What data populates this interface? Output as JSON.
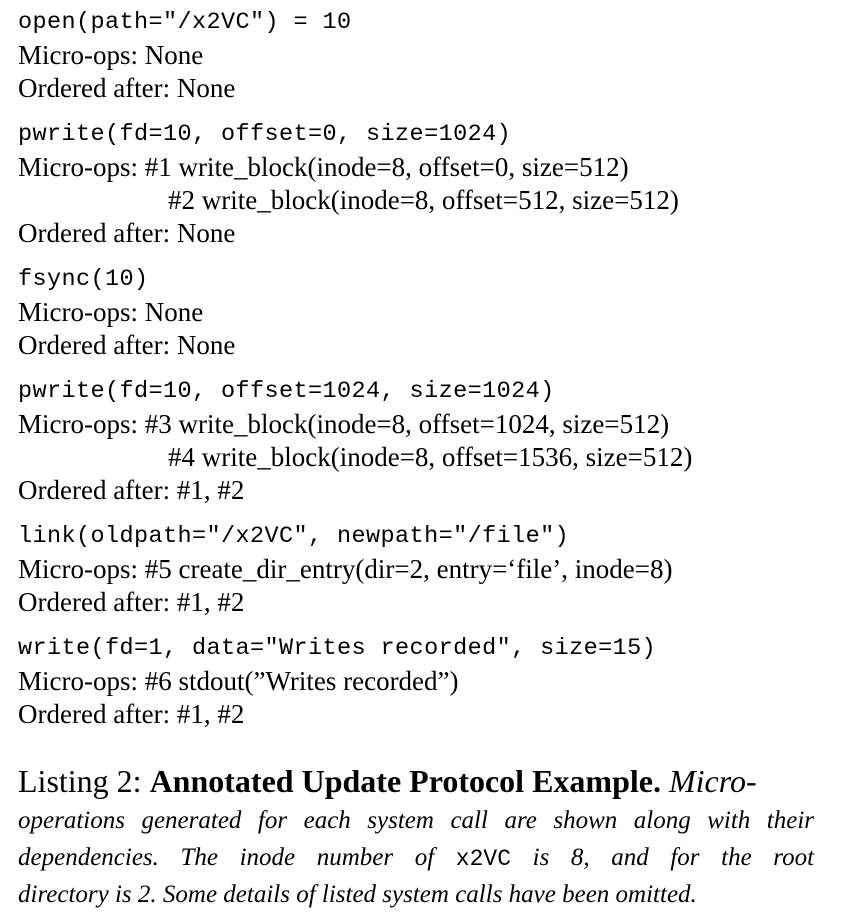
{
  "listing": {
    "blocks": [
      {
        "syscall": "open(path=\"/x2VC\") = 10",
        "microops_label": "Micro-ops:",
        "microops": [
          "None"
        ],
        "ordered_label": "Ordered after:",
        "ordered": "None"
      },
      {
        "syscall": "pwrite(fd=10, offset=0, size=1024)",
        "microops_label": "Micro-ops:",
        "microops": [
          "#1 write_block(inode=8, offset=0, size=512)",
          "#2 write_block(inode=8, offset=512, size=512)"
        ],
        "ordered_label": "Ordered after:",
        "ordered": "None"
      },
      {
        "syscall": "fsync(10)",
        "microops_label": "Micro-ops:",
        "microops": [
          "None"
        ],
        "ordered_label": "Ordered after:",
        "ordered": "None"
      },
      {
        "syscall": "pwrite(fd=10, offset=1024, size=1024)",
        "microops_label": "Micro-ops:",
        "microops": [
          "#3 write_block(inode=8, offset=1024, size=512)",
          "#4 write_block(inode=8, offset=1536, size=512)"
        ],
        "ordered_label": "Ordered after:",
        "ordered": "#1, #2"
      },
      {
        "syscall": "link(oldpath=\"/x2VC\", newpath=\"/file\")",
        "microops_label": "Micro-ops:",
        "microops": [
          "#5 create_dir_entry(dir=2, entry=‘file’, inode=8)"
        ],
        "ordered_label": "Ordered after:",
        "ordered": "#1, #2"
      },
      {
        "syscall": "write(fd=1, data=\"Writes recorded\", size=15)",
        "microops_label": "Micro-ops:",
        "microops": [
          "#6 stdout(”Writes recorded”)"
        ],
        "ordered_label": "Ordered after:",
        "ordered": "#1, #2"
      }
    ]
  },
  "caption": {
    "label": "Listing 2:",
    "title": "Annotated Update Protocol Example.",
    "line1_start": "Micro-",
    "line2": "operations generated for each system call are shown along with their",
    "line3_pre": "dependencies.  The inode number of",
    "line3_code": "x2VC",
    "line3_post": "is 8, and for the root",
    "line4": "directory is 2. Some details of listed system calls have been omitted."
  }
}
